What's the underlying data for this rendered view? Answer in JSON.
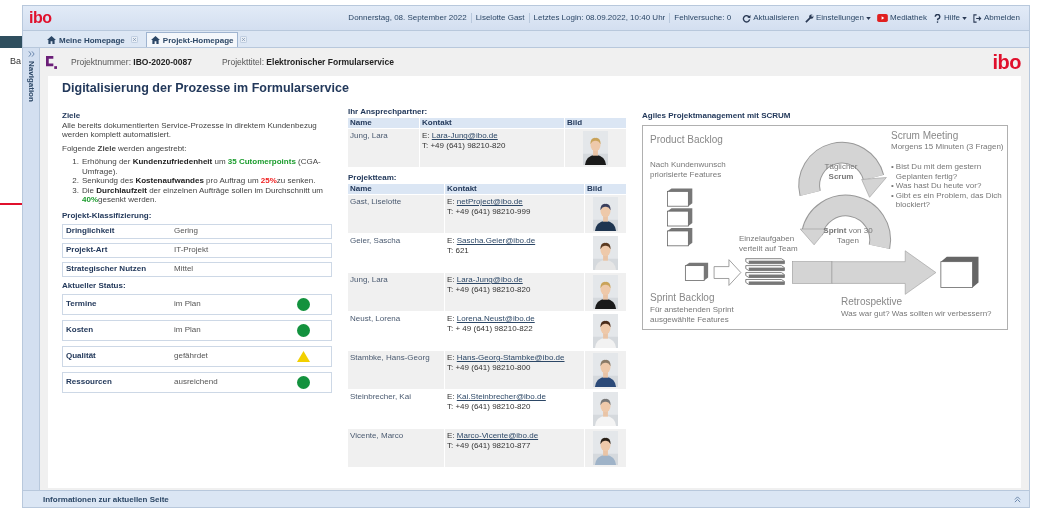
{
  "background_window": {
    "text": "Ba"
  },
  "header": {
    "logo": "ibo",
    "info": [
      "Donnerstag, 08. September 2022",
      "Liselotte Gast",
      "Letztes Login: 08.09.2022, 10:40 Uhr",
      "Fehlversuche: 0"
    ],
    "actions": [
      {
        "label": "Aktualisieren",
        "has_menu": false
      },
      {
        "label": "Einstellungen",
        "has_menu": true
      },
      {
        "label": "Mediathek",
        "has_menu": false
      },
      {
        "label": "Hilfe",
        "has_menu": true
      },
      {
        "label": "Abmelden",
        "has_menu": false
      }
    ]
  },
  "tabs": [
    {
      "label": "Meine Homepage",
      "selected": false
    },
    {
      "label": "Projekt-Homepage",
      "selected": true
    }
  ],
  "navigation": {
    "label": "Navigation"
  },
  "project": {
    "number_label": "Projektnummer:",
    "number": "IBO-2020-0087",
    "title_label": "Projekttitel:",
    "title": "Elektronischer Formularservice",
    "logo": "ibo"
  },
  "page_title": "Digitalisierung der Prozesse im Formularservice",
  "goals": {
    "heading": "Ziele",
    "text": "Alle bereits dokumentierten Service-Prozesse in direktem Kundenbezug werden komplett automatisiert.",
    "intro": "Folgende **Ziele** werden angestrebt:",
    "items": [
      {
        "number": "1.",
        "parts": [
          {
            "text": "Erhöhung der ",
            "kind": "plain"
          },
          {
            "text": "Kundenzufriedenheit",
            "kind": "bold"
          },
          {
            "text": " um ",
            "kind": "plain"
          },
          {
            "text": "35 Cutomerpoints",
            "kind": "positive"
          },
          {
            "text": " (CGA-Umfrage).",
            "kind": "plain"
          }
        ]
      },
      {
        "number": "2.",
        "parts": [
          {
            "text": "Senkundg des ",
            "kind": "plain"
          },
          {
            "text": "Kostenaufwandes",
            "kind": "bold"
          },
          {
            "text": " pro Auftrag um ",
            "kind": "plain"
          },
          {
            "text": "25%",
            "kind": "negative"
          },
          {
            "text": "zu senken.",
            "kind": "plain"
          }
        ]
      },
      {
        "number": "3.",
        "parts": [
          {
            "text": "Die ",
            "kind": "plain"
          },
          {
            "text": "Durchlaufzeit",
            "kind": "bold"
          },
          {
            "text": " der einzelnen Aufträge sollen im Durchschnitt um ",
            "kind": "plain"
          },
          {
            "text": "40%",
            "kind": "positive"
          },
          {
            "text": "gesenkt werden.",
            "kind": "plain"
          }
        ]
      }
    ]
  },
  "classification": {
    "heading": "Projekt-Klassifizierung:",
    "rows": [
      {
        "label": "Dringlichkeit",
        "value": "Gering"
      },
      {
        "label": "Projekt-Art",
        "value": "IT-Projekt"
      },
      {
        "label": "Strategischer Nutzen",
        "value": "Mittel"
      }
    ]
  },
  "status": {
    "heading": "Aktueller Status:",
    "rows": [
      {
        "label": "Termine",
        "value": "im Plan",
        "kind": "circle",
        "color": "#13923e"
      },
      {
        "label": "Kosten",
        "value": "im Plan",
        "kind": "circle",
        "color": "#13923e"
      },
      {
        "label": "Qualität",
        "value": "gefährdet",
        "kind": "triangle",
        "color": "#f2d000"
      },
      {
        "label": "Ressourcen",
        "value": "ausreichend",
        "kind": "circle",
        "color": "#13923e"
      }
    ]
  },
  "contact": {
    "heading": "Ihr Ansprechpartner:",
    "columns": [
      "Name",
      "Kontakt",
      "Bild"
    ],
    "rows": [
      {
        "name": "Jung, Lara",
        "email_label": "E:",
        "email": "Lara-Jung@ibo.de",
        "phone": "T: +49 (641) 98210-820"
      }
    ]
  },
  "team": {
    "heading": "Projektteam:",
    "columns": [
      "Name",
      "Kontakt",
      "Bild"
    ],
    "rows": [
      {
        "name": "Gast, Liselotte",
        "email_label": "E:",
        "email": "netProject@ibo.de",
        "phone": "T: +49 (641) 98210-999"
      },
      {
        "name": "Geier, Sascha",
        "email_label": "E:",
        "email": "Sascha.Geier@ibo.de",
        "phone": "T: 621"
      },
      {
        "name": "Jung, Lara",
        "email_label": "E:",
        "email": "Lara-Jung@ibo.de",
        "phone": "T: +49 (641) 98210-820"
      },
      {
        "name": "Neust, Lorena",
        "email_label": "E:",
        "email": "Lorena.Neust@ibo.de",
        "phone": "T: + 49 (641) 98210-822"
      },
      {
        "name": "Stambke, Hans-Georg",
        "email_label": "E:",
        "email": "Hans-Georg-Stambke@ibo.de",
        "phone": "T: +49 (641) 98210-800"
      },
      {
        "name": "Steinbrecher, Kai",
        "email_label": "E:",
        "email": "Kai.Steinbrecher@ibo.de",
        "phone": "T: +49 (641) 98210-820"
      },
      {
        "name": "Vicente, Marco",
        "email_label": "E:",
        "email": "Marco-Vicente@ibo.de",
        "phone": "T: +49 (641) 98210-877"
      }
    ]
  },
  "scrum": {
    "heading": "Agiles Projektmanagement mit SCRUM",
    "product_backlog": {
      "title": "Product Backlog",
      "text": "Nach Kundenwunsch priorisierte Features"
    },
    "sprint_backlog": {
      "title": "Sprint Backlog",
      "text": "Für anstehenden Sprint ausgewählte Features"
    },
    "tasks": "Einzelaufgaben verteilt auf Team",
    "daily": "Täglicher **Scrum**",
    "sprint": "**Sprint** von 30 Tagen",
    "meeting": {
      "title": "Scrum Meeting",
      "subtitle": "Morgens 15 Minuten (3 Fragen)",
      "questions": [
        {
          "bullet": "•",
          "text": "Bist Du mit dem gestern Geplanten fertig?"
        },
        {
          "bullet": "•",
          "text": "Was hast Du heute vor?"
        },
        {
          "bullet": "•",
          "text": "Gibt es ein Problem, das Dich blockiert?"
        }
      ]
    },
    "retro": {
      "title": "Retrospektive",
      "text": "Was war gut? Was sollten wir verbessern?"
    }
  },
  "info_bar": {
    "label": "Informationen zur aktuellen Seite"
  }
}
